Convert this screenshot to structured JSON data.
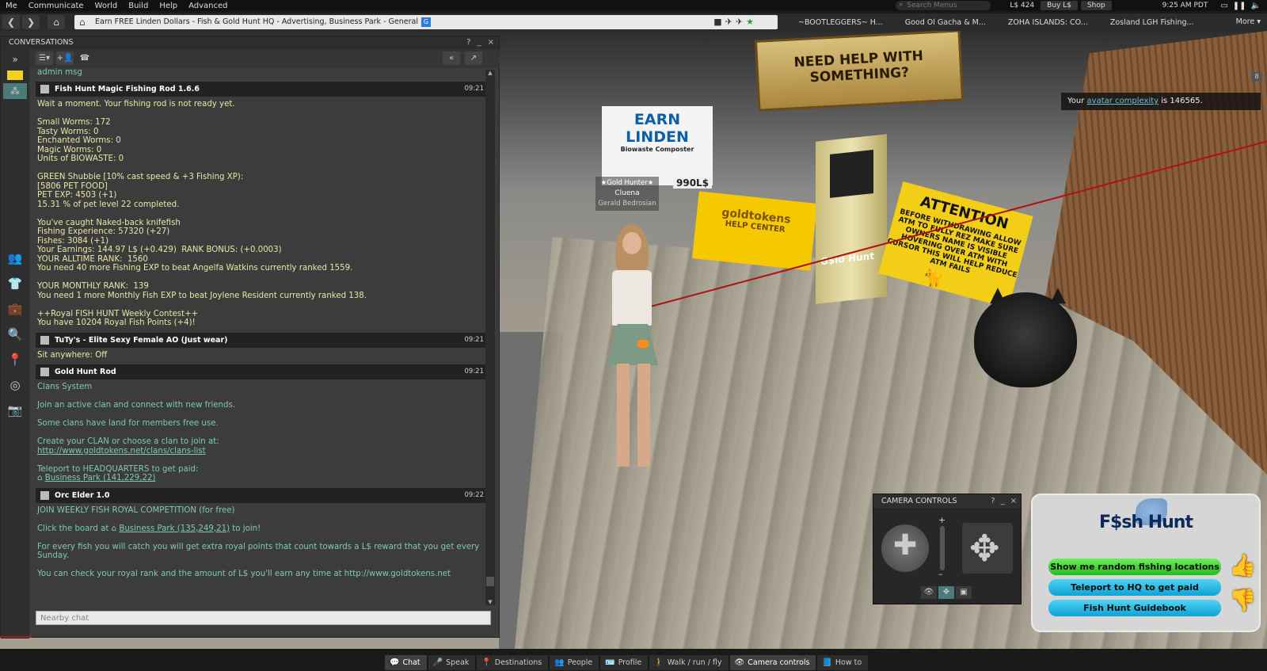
{
  "menubar": {
    "items": [
      "Me",
      "Communicate",
      "World",
      "Build",
      "Help",
      "Advanced"
    ],
    "search_placeholder": "Search Menus",
    "balance": "L$ 424",
    "buy_label": "Buy L$",
    "shop_label": "Shop",
    "clock": "9:25 AM PDT",
    "status_icons": [
      "window-icon",
      "pause-icon",
      "volume-icon"
    ]
  },
  "navbar": {
    "location": "Earn FREE Linden Dollars - Fish & Gold Hunt HQ - Advertising, Business Park - General",
    "location_badge": "G",
    "favorites": [
      "~BOOTLEGGERS~ H...",
      "Good Ol Gacha & M...",
      "ZOHA ISLANDS: CO...",
      "Zosland LGH Fishing..."
    ],
    "more_label": "More"
  },
  "world": {
    "help_sign": "NEED HELP WITH SOMETHING?",
    "attention_title": "ATTENTION",
    "attention_text": "BEFORE WITHDRAWING ALLOW ATM TO FULLY REZ MAKE SURE OWNERS NAME IS VISIBLE HOVERING OVER ATM WITH CURSOR THIS WILL HELP REDUCE ATM FAILS",
    "goldtokens_sign": "goldtokens",
    "goldtokens_sub": "HELP CENTER",
    "earn_sign": "EARN LINDEN",
    "earn_sub": "Biowaste Composter",
    "price": "990L$",
    "atm_label": "G$ld Hunt",
    "nametag": {
      "group": "★Gold Hunter★",
      "display": "Cluena",
      "legacy": "Gerald Bedrosian"
    },
    "corner_badge": "8",
    "complexity_prefix": "Your",
    "complexity_link": "avatar complexity",
    "complexity_suffix": "is 146565."
  },
  "conversations": {
    "title": "CONVERSATIONS",
    "title_buttons": [
      "?",
      "_",
      "×"
    ],
    "admin_msg": "admin msg",
    "messages": [
      {
        "sender": "Fish Hunt Magic Fishing Rod 1.6.6",
        "time": "09:21",
        "style": "yellow",
        "text": "Wait a moment. Your fishing rod is not ready yet.\n\nSmall Worms: 172\nTasty Worms: 0\nEnchanted Worms: 0\nMagic Worms: 0\nUnits of BIOWASTE: 0\n\nGREEN Shubbie [10% cast speed & +3 Fishing XP):\n[5806 PET FOOD]\nPET EXP: 4503 (+1)\n15.31 % of pet level 22 completed.\n\nYou've caught Naked-back knifefish\nFishing Experience: 57320 (+27)\nFishes: 3084 (+1)\nYour Earnings: 144.97 L$ (+0.429)  RANK BONUS: (+0.0003)\nYOUR ALLTIME RANK:  1560\nYou need 40 more Fishing EXP to beat Angelfa Watkins currently ranked 1559.\n\nYOUR MONTHLY RANK:  139\nYou need 1 more Monthly Fish EXP to beat Joylene Resident currently ranked 138.\n\n++Royal FISH HUNT Weekly Contest++\nYou have 10204 Royal Fish Points (+4)!"
      },
      {
        "sender": "TuTy's - Elite Sexy Female AO (Just wear)",
        "time": "09:21",
        "style": "yellow",
        "text": "Sit anywhere: Off"
      },
      {
        "sender": "Gold Hunt Rod",
        "time": "09:21",
        "style": "teal",
        "text": "Clans System\n\nJoin an active clan and connect with new friends.\n\nSome clans have land for members free use.\n\nCreate your CLAN or choose a clan to join at:",
        "link1": "http://www.goldtokens.net/clans/clans-list",
        "text2": "Teleport to HEADQUARTERS to get paid:",
        "link2": "Business Park (141,229,22)"
      },
      {
        "sender": "Orc Elder 1.0",
        "time": "09:22",
        "style": "teal",
        "text": "JOIN WEEKLY FISH ROYAL COMPETITION (for free)",
        "text2_prefix": "Click the board at",
        "link": "Business Park (135,249,21)",
        "text2_suffix": "to join!",
        "text3": "For every fish you will catch you will get extra royal points that count towards a L$ reward that you get every Sunday.",
        "text4": "You can check your royal rank and the amount of L$ you'll earn any time at http://www.goldtokens.net"
      }
    ],
    "nearby_placeholder": "Nearby chat"
  },
  "camera_controls": {
    "title": "CAMERA CONTROLS",
    "title_buttons": [
      "?",
      "_",
      "×"
    ]
  },
  "fishhunt": {
    "logo": "F$sh Hunt",
    "btn_random": "Show me random fishing locations",
    "btn_teleport": "Teleport to HQ to get paid",
    "btn_guide": "Fish Hunt Guidebook"
  },
  "bottom_toolbar": {
    "buttons": [
      {
        "label": "Chat",
        "icon": "chat-icon",
        "active": true
      },
      {
        "label": "Speak",
        "icon": "microphone-icon",
        "active": false
      },
      {
        "label": "Destinations",
        "icon": "map-pin-icon",
        "active": false
      },
      {
        "label": "People",
        "icon": "people-icon",
        "active": false
      },
      {
        "label": "Profile",
        "icon": "profile-card-icon",
        "active": false
      },
      {
        "label": "Walk / run / fly",
        "icon": "walk-icon",
        "active": false
      },
      {
        "label": "Camera controls",
        "icon": "eye-icon",
        "active": true
      },
      {
        "label": "How to",
        "icon": "help-book-icon",
        "active": false
      }
    ]
  }
}
